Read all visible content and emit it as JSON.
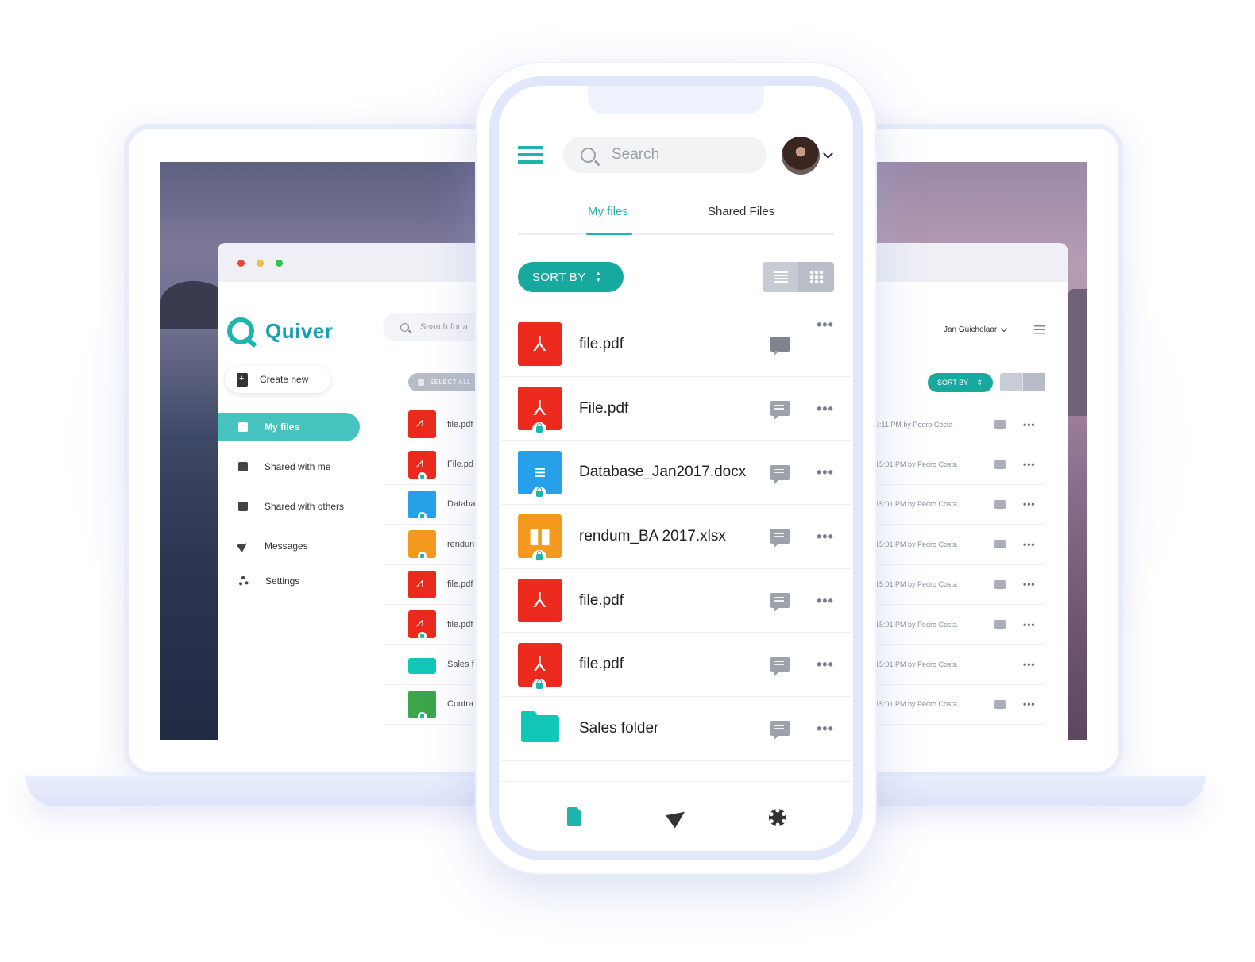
{
  "colors": {
    "accent": "#1fb5ac",
    "accent_dark": "#17a89e",
    "pdf_red": "#eb2a1d",
    "doc_blue": "#27a0ea",
    "xlsx_orange": "#f39a1e",
    "folder_teal": "#12c6b8",
    "sheet_green": "#3aa648"
  },
  "desktop": {
    "brand": "Quiver",
    "create_new": "Create new",
    "nav": [
      {
        "label": "My files",
        "icon": "file-icon"
      },
      {
        "label": "Shared with me",
        "icon": "shared-folder-icon"
      },
      {
        "label": "Shared with others",
        "icon": "shared-others-icon"
      },
      {
        "label": "Messages",
        "icon": "send-icon"
      },
      {
        "label": "Settings",
        "icon": "gear-icon"
      }
    ],
    "search_placeholder": "Search for a",
    "select_all": "SELECT ALL",
    "files": [
      {
        "name": "file.pdf",
        "type": "pdf",
        "locked": false
      },
      {
        "name": "File.pd",
        "type": "pdf",
        "locked": true
      },
      {
        "name": "Databa",
        "type": "docx",
        "locked": true
      },
      {
        "name": "rendun",
        "type": "xlsx",
        "locked": true
      },
      {
        "name": "file.pdf",
        "type": "pdf",
        "locked": false
      },
      {
        "name": "file.pdf",
        "type": "pdf",
        "locked": true
      },
      {
        "name": "Sales f",
        "type": "folder",
        "locked": false
      },
      {
        "name": "Contra",
        "type": "sheet",
        "locked": true
      }
    ],
    "user_name": "Jan Guichelaar",
    "sort_by": "SORT BY",
    "meta_rows": [
      {
        "meta": "3:11 PM  by Pedro Costa",
        "comment": true
      },
      {
        "meta": "15:01 PM  by Pedro Costa",
        "comment": true
      },
      {
        "meta": "15:01 PM  by Pedro Costa",
        "comment": true
      },
      {
        "meta": "15:01 PM  by Pedro Costa",
        "comment": true
      },
      {
        "meta": "15:01 PM  by Pedro Costa",
        "comment": true
      },
      {
        "meta": "15:01 PM  by Pedro Costa",
        "comment": true
      },
      {
        "meta": "15:01 PM  by Pedro Costa",
        "comment": false
      },
      {
        "meta": "15:01 PM  by Pedro Costa",
        "comment": true
      }
    ],
    "more": "•••"
  },
  "mobile": {
    "search_placeholder": "Search",
    "tabs": {
      "my_files": "My files",
      "shared_files": "Shared Files"
    },
    "sort_by": "SORT BY",
    "files": [
      {
        "name": "file.pdf",
        "type": "pdf",
        "locked": false
      },
      {
        "name": "File.pdf",
        "type": "pdf",
        "locked": true
      },
      {
        "name": "Database_Jan2017.docx",
        "type": "docx",
        "locked": true
      },
      {
        "name": "rendum_BA 2017.xlsx",
        "type": "xlsx",
        "locked": true
      },
      {
        "name": "file.pdf",
        "type": "pdf",
        "locked": false
      },
      {
        "name": "file.pdf",
        "type": "pdf",
        "locked": true
      },
      {
        "name": "Sales folder",
        "type": "folder",
        "locked": false
      }
    ],
    "more": "•••",
    "bottom_nav": [
      "file-icon",
      "send-icon",
      "gear-icon"
    ]
  }
}
